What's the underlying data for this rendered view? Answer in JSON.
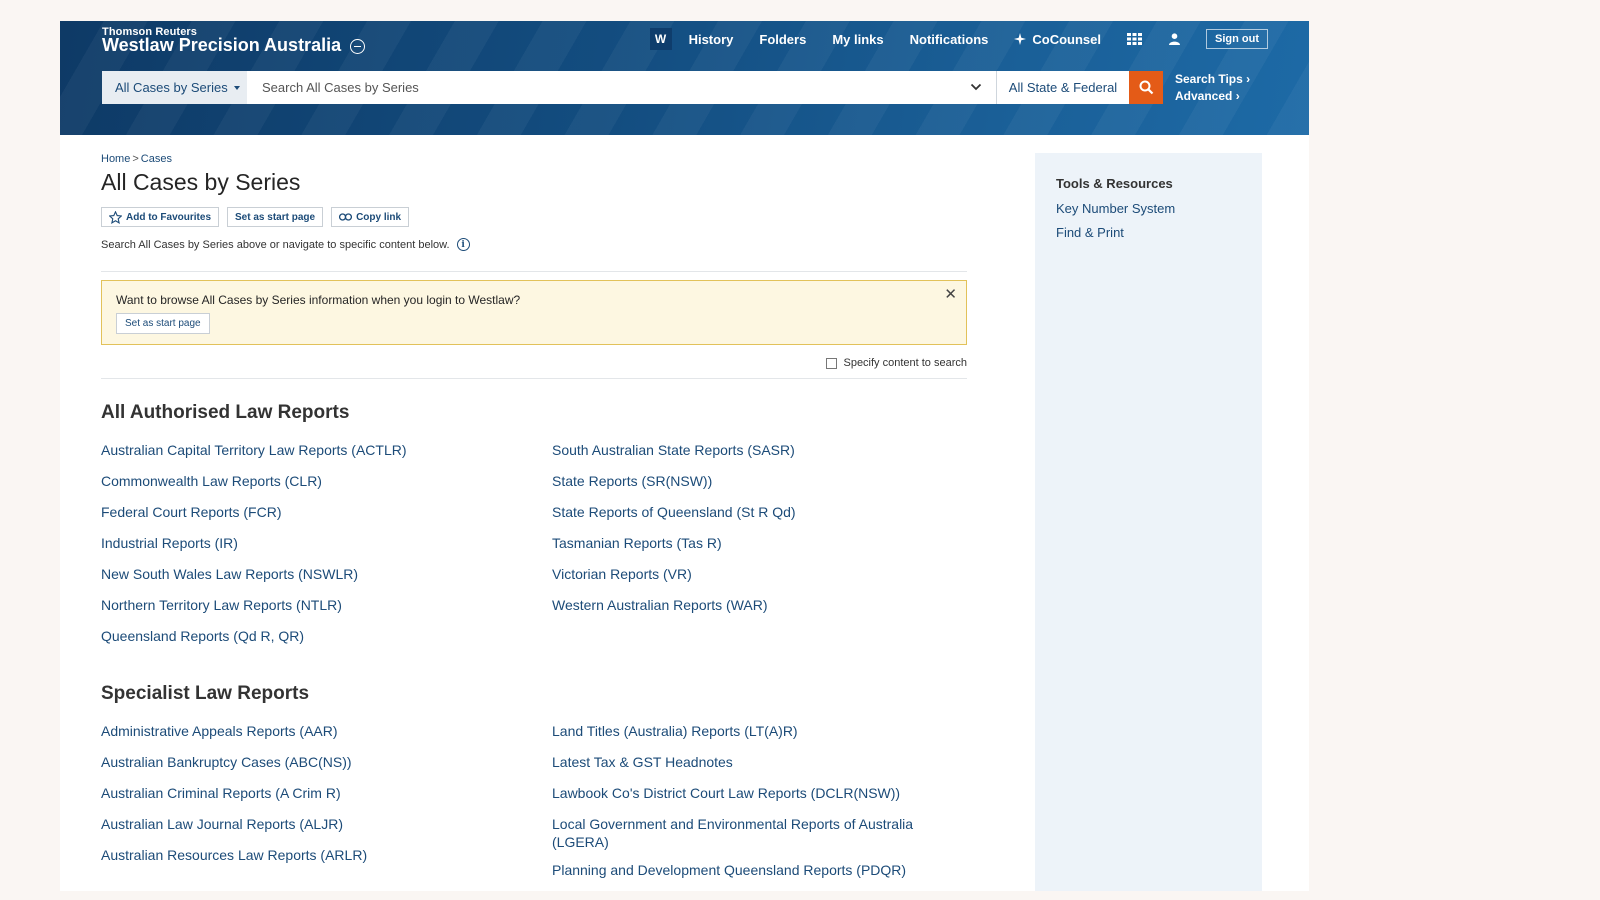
{
  "header": {
    "brand_top": "Thomson Reuters",
    "brand_main": "Westlaw Precision Australia",
    "w_label": "W",
    "nav": [
      "History",
      "Folders",
      "My links",
      "Notifications"
    ],
    "cocounsel": "CoCounsel",
    "signout": "Sign out",
    "search": {
      "scope": "All Cases by Series",
      "placeholder": "Search All Cases by Series",
      "jurisdiction": "All State & Federal",
      "tips": "Search Tips",
      "advanced": "Advanced"
    }
  },
  "breadcrumb": {
    "home": "Home",
    "sep": ">",
    "current": "Cases"
  },
  "page_title": "All Cases by Series",
  "actions": {
    "favourites": "Add to Favourites",
    "start_page": "Set as start page",
    "copy_link": "Copy link"
  },
  "hint": "Search All Cases by Series above or navigate to specific content below.",
  "banner": {
    "message": "Want to browse All Cases by Series information when you login to Westlaw?",
    "button": "Set as start page"
  },
  "specify": "Specify content to search",
  "sections": [
    {
      "title": "All Authorised Law Reports",
      "left": [
        "Australian Capital Territory Law Reports (ACTLR)",
        "Commonwealth Law Reports (CLR)",
        "Federal Court Reports (FCR)",
        "Industrial Reports (IR)",
        "New South Wales Law Reports (NSWLR)",
        "Northern Territory Law Reports (NTLR)",
        "Queensland Reports (Qd R, QR)"
      ],
      "right": [
        "South Australian State Reports (SASR)",
        "State Reports (SR(NSW))",
        "State Reports of Queensland (St R Qd)",
        "Tasmanian Reports (Tas R)",
        "Victorian Reports (VR)",
        "Western Australian Reports (WAR)"
      ]
    },
    {
      "title": "Specialist Law Reports",
      "left": [
        "Administrative Appeals Reports (AAR)",
        "Australian Bankruptcy Cases (ABC(NS))",
        "Australian Criminal Reports (A Crim R)",
        "Australian Law Journal Reports (ALJR)",
        "Australian Resources Law Reports (ARLR)"
      ],
      "right": [
        "Land Titles (Australia) Reports (LT(A)R)",
        "Latest Tax & GST Headnotes",
        "Lawbook Co's District Court Law Reports (DCLR(NSW))",
        "Local Government and Environmental Reports of Australia (LGERA)",
        "Planning and Development Queensland Reports (PDQR)"
      ]
    }
  ],
  "sidebar": {
    "title": "Tools & Resources",
    "links": [
      "Key Number System",
      "Find & Print"
    ]
  },
  "colors": {
    "header_dark": "#0e3a66",
    "header_light": "#1d6aa6",
    "search_button": "#e45b17",
    "link": "#1c4b78",
    "banner_bg": "#fdf7e1",
    "banner_border": "#e2c25a",
    "sidebar_bg": "#edf3f9"
  }
}
